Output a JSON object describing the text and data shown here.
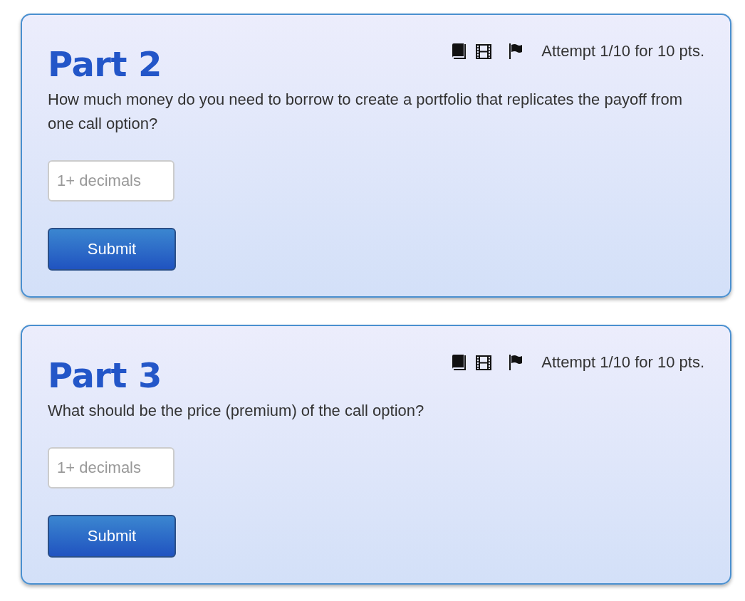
{
  "parts": [
    {
      "title": "Part 2",
      "attempt": "Attempt 1/10 for 10 pts.",
      "question": "How much money do you need to borrow to create a portfolio that replicates the payoff from one call option?",
      "answer": {
        "placeholder": "1+ decimals"
      },
      "button": "Submit"
    },
    {
      "title": "Part 3",
      "attempt": "Attempt 1/10 for 10 pts.",
      "question": "What should be the price (premium) of the call option?",
      "answer": {
        "placeholder": "1+ decimals"
      },
      "button": "Submit"
    }
  ]
}
